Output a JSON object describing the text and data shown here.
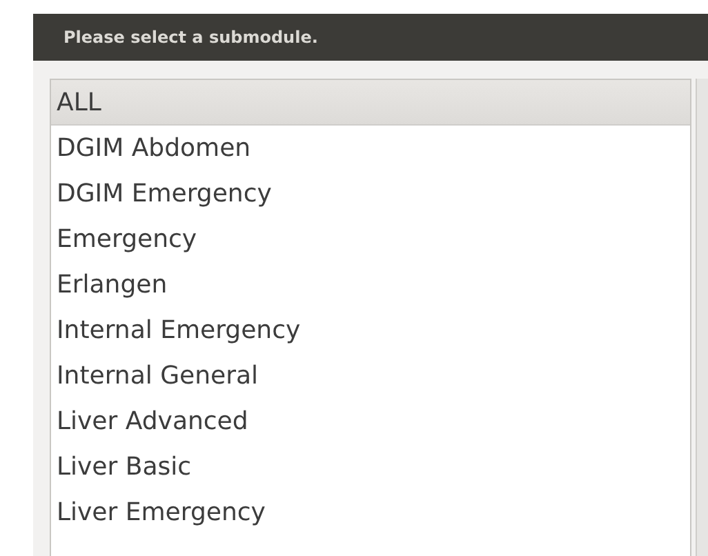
{
  "header": {
    "title": "Please select a submodule."
  },
  "submodules": [
    {
      "label": "ALL",
      "selected": true
    },
    {
      "label": "DGIM Abdomen",
      "selected": false
    },
    {
      "label": "DGIM Emergency",
      "selected": false
    },
    {
      "label": "Emergency",
      "selected": false
    },
    {
      "label": "Erlangen",
      "selected": false
    },
    {
      "label": "Internal Emergency",
      "selected": false
    },
    {
      "label": "Internal General",
      "selected": false
    },
    {
      "label": "Liver Advanced",
      "selected": false
    },
    {
      "label": "Liver Basic",
      "selected": false
    },
    {
      "label": "Liver Emergency",
      "selected": false
    }
  ]
}
